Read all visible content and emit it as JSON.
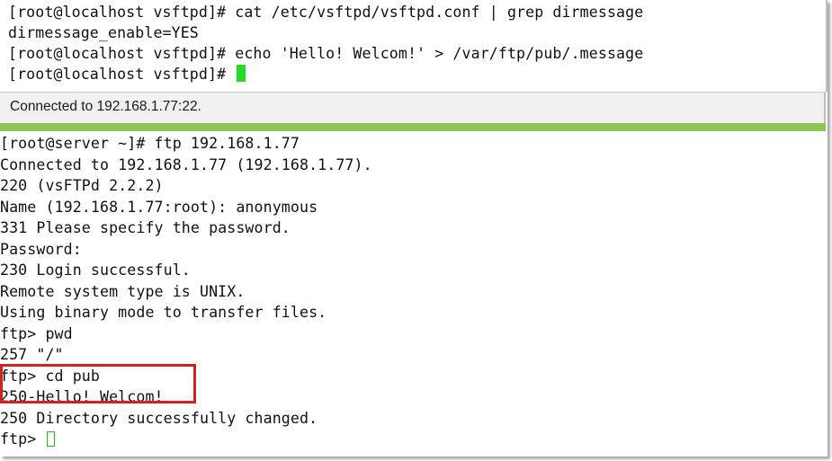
{
  "top_terminal": {
    "lines": [
      "[root@localhost vsftpd]# cat /etc/vsftpd/vsftpd.conf | grep dirmessage",
      "dirmessage_enable=YES",
      "[root@localhost vsftpd]# echo 'Hello! Welcom!' > /var/ftp/pub/.message",
      "[root@localhost vsftpd]# "
    ],
    "cursor_color": "#22dd22"
  },
  "status_bar": {
    "text": "Connected to 192.168.1.77:22."
  },
  "accent_color": "#8dc454",
  "bottom_terminal": {
    "lines": [
      "[root@server ~]# ftp 192.168.1.77",
      "Connected to 192.168.1.77 (192.168.1.77).",
      "220 (vsFTPd 2.2.2)",
      "Name (192.168.1.77:root): anonymous",
      "331 Please specify the password.",
      "Password:",
      "230 Login successful.",
      "Remote system type is UNIX.",
      "Using binary mode to transfer files.",
      "ftp> pwd",
      "257 \"/\"",
      "ftp> cd pub",
      "250-Hello! Welcom!",
      "250 Directory successfully changed.",
      "ftp> "
    ],
    "highlight_color": "#d42020"
  }
}
